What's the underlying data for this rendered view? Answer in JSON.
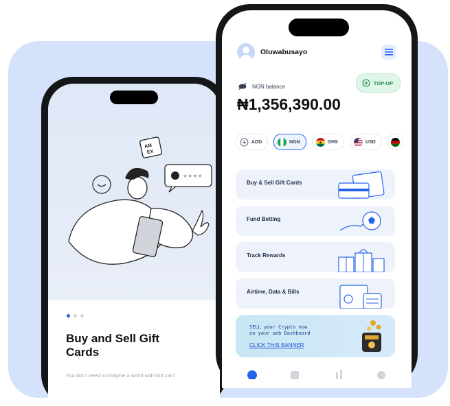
{
  "onboarding": {
    "title": "Buy and Sell Gift Cards",
    "description": "You don't need to imagine a world with Gift card",
    "illustration_badge": "AM EX"
  },
  "header": {
    "username": "Oluwabusayo",
    "menu_icon": "hamburger-icon"
  },
  "wallet": {
    "balance_label": "NGN balance",
    "balance_value": "₦1,356,390.00",
    "topup_label": "TOP-UP",
    "hide_icon": "eye-slash-icon"
  },
  "currencies": [
    {
      "label": "ADD",
      "icon": "plus-circle-icon"
    },
    {
      "label": "NGN",
      "icon": "nigeria-flag",
      "active": true
    },
    {
      "label": "GHS",
      "icon": "ghana-flag"
    },
    {
      "label": "USD",
      "icon": "us-flag"
    }
  ],
  "services": [
    {
      "label": "Buy & Sell Gift Cards",
      "icon": "gift-cards-illustration"
    },
    {
      "label": "Fund Betting",
      "icon": "soccer-ball-illustration"
    },
    {
      "label": "Track Rewards",
      "icon": "gift-boxes-illustration"
    },
    {
      "label": "Airtime, Data & Bills",
      "icon": "bills-illustration"
    }
  ],
  "banner": {
    "line1": "SELL your Crypto now",
    "line2": "on your web Dashboard",
    "link": "CLICK THIS BANNER"
  },
  "colors": {
    "accent": "#2563eb",
    "background_card": "#d4e2fb",
    "topup_green": "#1d8a4c"
  }
}
